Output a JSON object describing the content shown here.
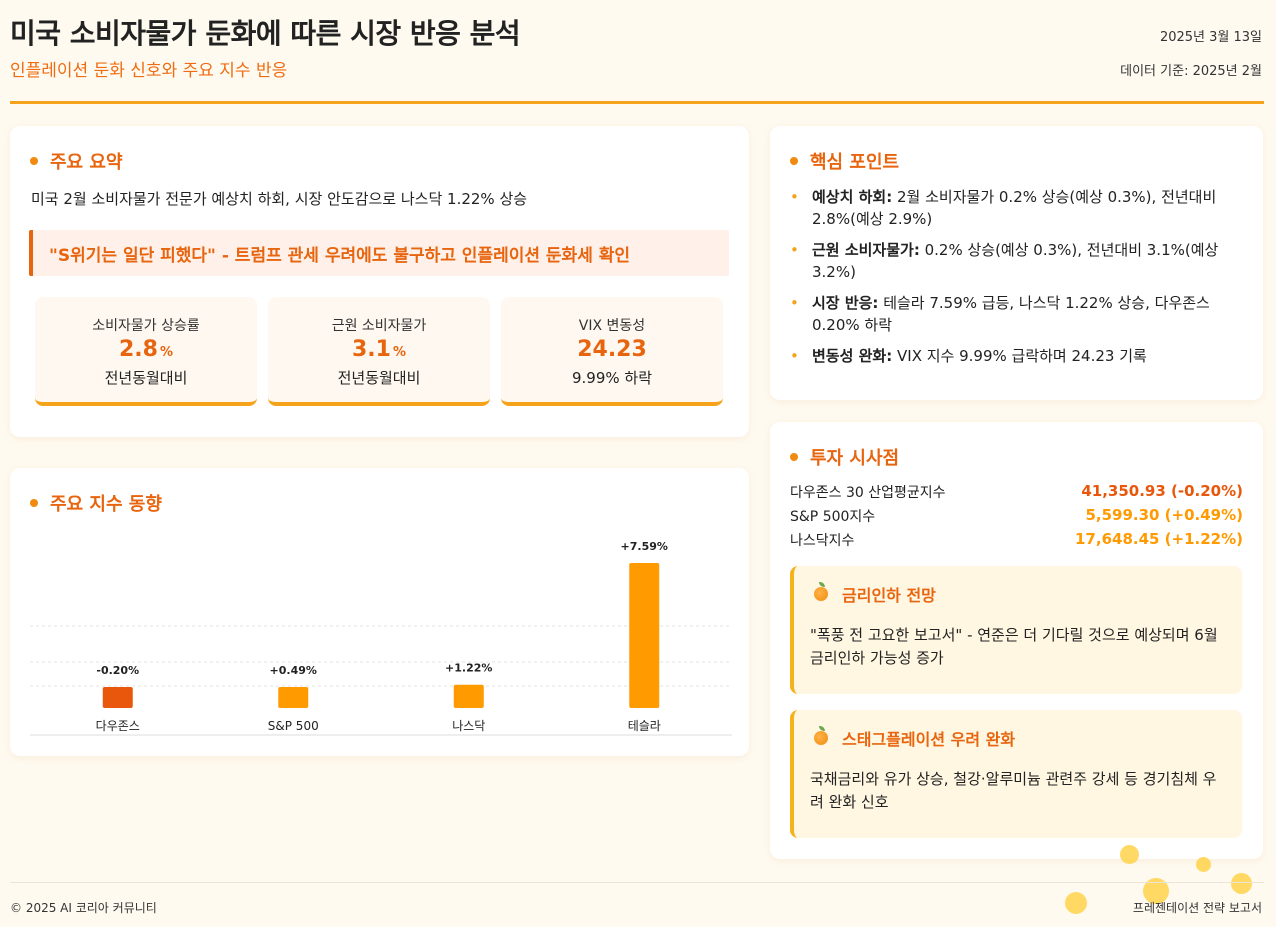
{
  "header": {
    "title": "미국 소비자물가 둔화에 따른 시장 반응 분석",
    "subtitle": "인플레이션 둔화 신호와 주요 지수 반응",
    "date": "2025년 3월 13일",
    "data_basis": "데이터 기준: 2025년 2월"
  },
  "summary": {
    "title": "주요 요약",
    "text": "미국 2월 소비자물가 전문가 예상치 하회, 시장 안도감으로 나스닥 1.22% 상승",
    "quote": "\"S위기는 일단 피했다\" - 트럼프 관세 우려에도 불구하고 인플레이션 둔화세 확인",
    "stats": [
      {
        "label": "소비자물가 상승률",
        "value": "2.8",
        "unit": "%",
        "sub": "전년동월대비"
      },
      {
        "label": "근원 소비자물가",
        "value": "3.1",
        "unit": "%",
        "sub": "전년동월대비"
      },
      {
        "label": "VIX 변동성",
        "value": "24.23",
        "unit": "",
        "sub": "9.99% 하락"
      }
    ]
  },
  "indices_section": {
    "title": "주요 지수 동향"
  },
  "chart_data": {
    "type": "bar",
    "categories": [
      "다우존스",
      "S&P 500",
      "나스닥",
      "테슬라"
    ],
    "values": [
      -0.2,
      0.49,
      1.22,
      7.59
    ],
    "data_labels": [
      "-0.20%",
      "+0.49%",
      "+1.22%",
      "+7.59%"
    ],
    "colors": [
      "#e8570c",
      "#ff9a00",
      "#ff9a00",
      "#ff9a00"
    ],
    "title": "",
    "xlabel": "",
    "ylabel": "",
    "grid": true,
    "legend": "none"
  },
  "key_points": {
    "title": "핵심 포인트",
    "items": [
      {
        "head": "예상치 하회:",
        "text": " 2월 소비자물가 0.2% 상승(예상 0.3%), 전년대비 2.8%(예상 2.9%)"
      },
      {
        "head": "근원 소비자물가:",
        "text": " 0.2% 상승(예상 0.3%), 전년대비 3.1%(예상 3.2%)"
      },
      {
        "head": "시장 반응:",
        "text": " 테슬라 7.59% 급등, 나스닥 1.22% 상승, 다우존스 0.20% 하락"
      },
      {
        "head": "변동성 완화:",
        "text": " VIX 지수 9.99% 급락하며 24.23 기록"
      }
    ]
  },
  "investment": {
    "title": "투자 시사점",
    "indices": [
      {
        "name": "다우존스 30 산업평균지수",
        "value": "41,350.93 (-0.20%)",
        "color": "#e8570c"
      },
      {
        "name": "S&P 500지수",
        "value": "5,599.30 (+0.49%)",
        "color": "#ff9a00"
      },
      {
        "name": "나스닥지수",
        "value": "17,648.45 (+1.22%)",
        "color": "#ff9a00"
      }
    ],
    "boxes": [
      {
        "title": "금리인하 전망",
        "text": "\"폭풍 전 고요한 보고서\" - 연준은 더 기다릴 것으로 예상되며 6월 금리인하 가능성 증가",
        "icon": "orange-fruit-icon"
      },
      {
        "title": "스태그플레이션 우려 완화",
        "text": "국채금리와 유가 상승, 철강·알루미늄 관련주 강세 등 경기침체 우려 완화 신호",
        "icon": "orange-fruit-icon"
      }
    ]
  },
  "footer": {
    "copyright": "© 2025 AI 코리아 커뮤니티",
    "right": "프레젠테이션 전략 보고서"
  }
}
